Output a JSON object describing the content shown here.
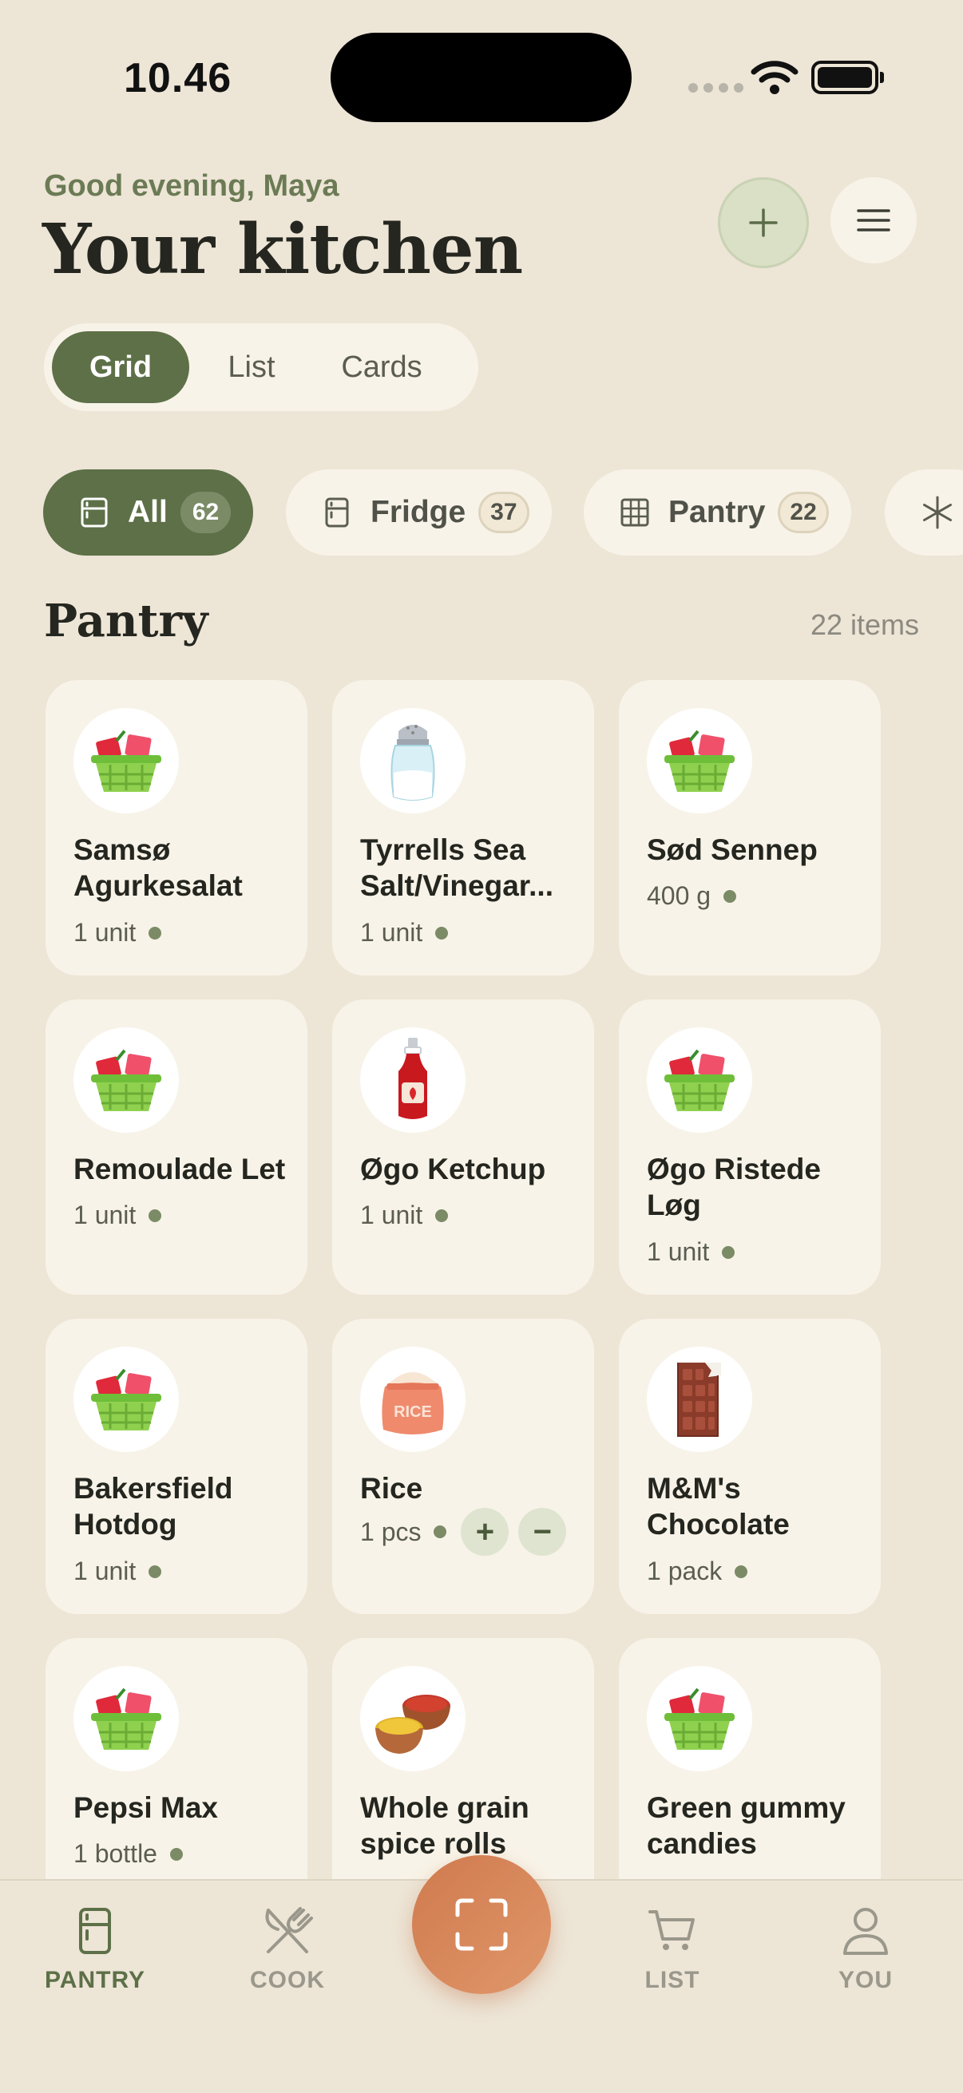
{
  "status_bar": {
    "time": "10.46"
  },
  "header": {
    "greeting": "Good evening, Maya",
    "title": "Your kitchen"
  },
  "view_toggle": [
    "Grid",
    "List",
    "Cards"
  ],
  "filters": [
    {
      "label": "All",
      "count": "62",
      "icon": "fridge-icon"
    },
    {
      "label": "Fridge",
      "count": "37",
      "icon": "fridge-icon"
    },
    {
      "label": "Pantry",
      "count": "22",
      "icon": "grid-icon"
    },
    {
      "label": "",
      "count": "",
      "icon": "snowflake-icon"
    }
  ],
  "section": {
    "title": "Pantry",
    "count": "22 items"
  },
  "items": [
    {
      "name": "Samsø Agurkesalat",
      "qty": "1 unit",
      "icon": "basket-icon"
    },
    {
      "name": "Tyrrells Sea Salt/Vinegar...",
      "qty": "1 unit",
      "icon": "salt-shaker-icon"
    },
    {
      "name": "Sød Sennep",
      "qty": "400 g",
      "icon": "basket-icon"
    },
    {
      "name": "Remoulade Let",
      "qty": "1 unit",
      "icon": "basket-icon"
    },
    {
      "name": "Øgo Ketchup",
      "qty": "1 unit",
      "icon": "ketchup-bottle-icon"
    },
    {
      "name": "Øgo Ristede Løg",
      "qty": "1 unit",
      "icon": "basket-icon"
    },
    {
      "name": "Bakersfield Hotdog",
      "qty": "1 unit",
      "icon": "basket-icon"
    },
    {
      "name": "Rice",
      "qty": "1 pcs",
      "icon": "rice-bag-icon",
      "rice_label": "RICE"
    },
    {
      "name": "M&M's Chocolate",
      "qty": "1 pack",
      "icon": "chocolate-bar-icon"
    },
    {
      "name": "Pepsi Max",
      "qty": "1 bottle",
      "icon": "basket-icon"
    },
    {
      "name": "Whole grain spice rolls",
      "qty": "",
      "icon": "spice-bowls-icon"
    },
    {
      "name": "Green gummy candies",
      "qty": "",
      "icon": "basket-icon"
    }
  ],
  "stepper": {
    "plus": "+",
    "minus": "−"
  },
  "tab_bar": {
    "pantry": "PANTRY",
    "cook": "COOK",
    "list": "LIST",
    "you": "YOU"
  },
  "colors": {
    "background": "#ede5d6",
    "card": "#f8f3e8",
    "accent_green": "#5d7048",
    "scan_orange": "#d9875a"
  }
}
